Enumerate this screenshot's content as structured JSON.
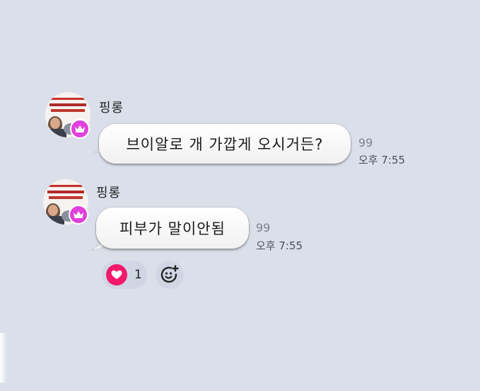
{
  "colors": {
    "background": "#dbdfe9",
    "badge": "#e040dc",
    "heart": "#f3186a",
    "reaction_bg": "#d1d6e4"
  },
  "messages": [
    {
      "sender": "핑롱",
      "text": "브이알로 개 가깝게 오시거든?",
      "read_count": "99",
      "time": "오후 7:55",
      "avatar_icon": "profile-avatar",
      "badge_icon": "crown-icon"
    },
    {
      "sender": "핑롱",
      "text": "피부가 말이안됨",
      "read_count": "99",
      "time": "오후 7:55",
      "avatar_icon": "profile-avatar",
      "badge_icon": "crown-icon"
    }
  ],
  "reactions": [
    {
      "icon": "heart-icon",
      "count": "1"
    }
  ],
  "add_reaction_icon": "add-emoji-icon"
}
